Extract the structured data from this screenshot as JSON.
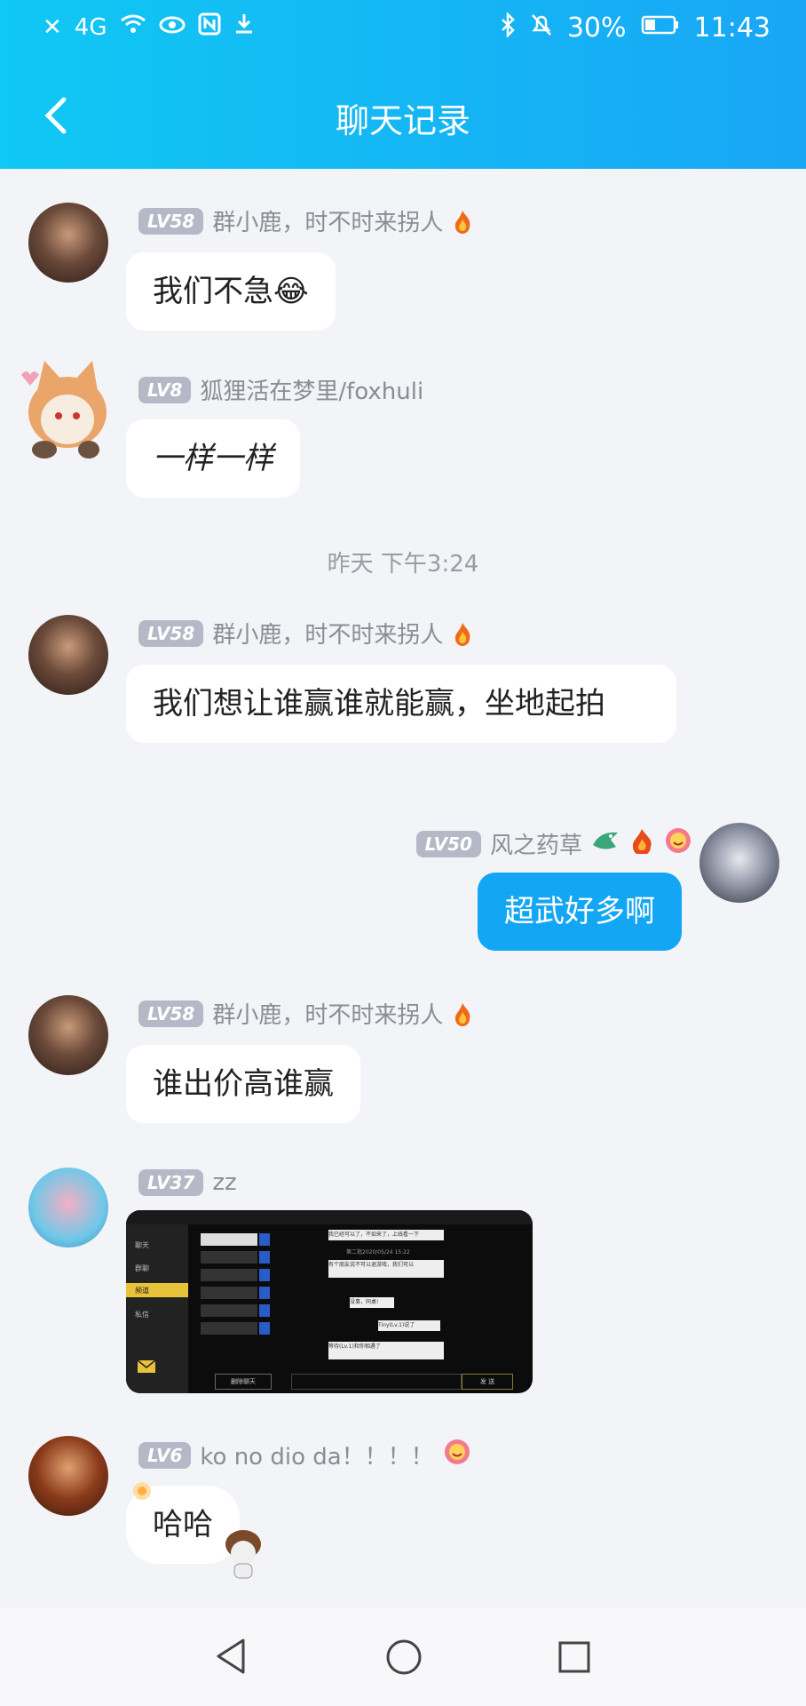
{
  "status_bar": {
    "left_signal": "4G",
    "battery": "30%",
    "time": "11:43"
  },
  "header": {
    "title": "聊天记录"
  },
  "messages": [
    {
      "lv": "LV58",
      "name": "群小鹿，时不时来拐人",
      "text": "我们不急😂"
    },
    {
      "lv": "LV8",
      "name": "狐狸活在梦里/foxhuli",
      "text": "一样一样"
    },
    {
      "lv": "LV58",
      "name": "群小鹿，时不时来拐人",
      "text": "我们想让谁赢谁就能赢，坐地起拍"
    },
    {
      "lv": "LV50",
      "name": "风之药草",
      "text": "超武好多啊"
    },
    {
      "lv": "LV58",
      "name": "群小鹿，时不时来拐人",
      "text": "谁出价高谁赢"
    },
    {
      "lv": "LV37",
      "name": "zz",
      "text": ""
    },
    {
      "lv": "LV6",
      "name": "ko no dio da！！！！",
      "text": "哈哈"
    }
  ],
  "time_divider": "昨天 下午3:24",
  "screenshot_card": {
    "tabs": [
      "聊天",
      "群聊",
      "频道",
      "私信"
    ],
    "send_label": "发 送",
    "close_label": "删除聊天",
    "chat_lines": [
      "我已经可以了，不如来了，上线看一下",
      "第二批2020/05/24 15:22",
      "有个朋友说不可以退游戏，我们可以",
      "没事，同桌!",
      "Tiny(Lv.1)说了",
      "等待(Lv.1)和你相遇了"
    ]
  },
  "colors": {
    "header_start": "#10c8f4",
    "header_end": "#18a6f5",
    "my_bubble": "#12a6f5",
    "background": "#f3f4f8"
  }
}
